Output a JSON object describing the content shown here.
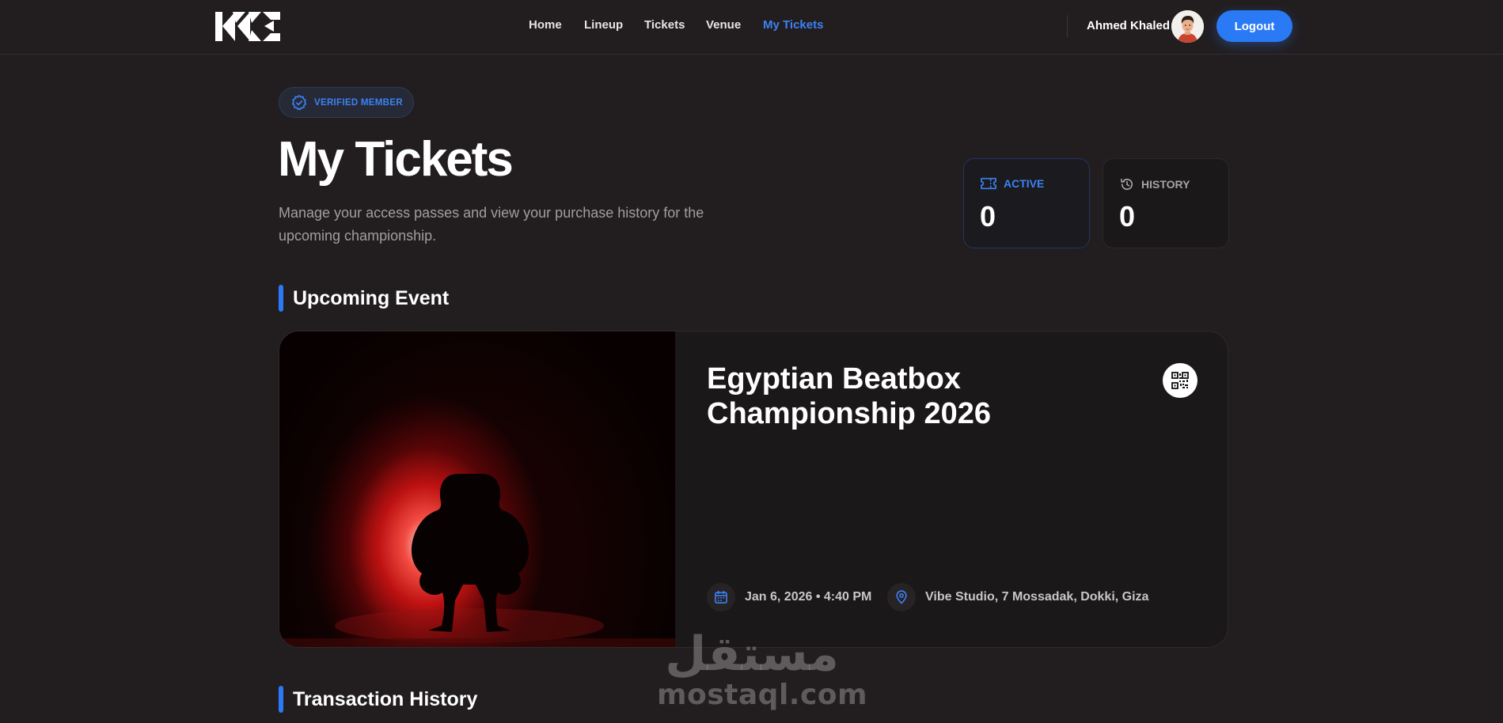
{
  "nav": {
    "links": [
      "Home",
      "Lineup",
      "Tickets",
      "Venue",
      "My Tickets"
    ],
    "active": "My Tickets",
    "user_name": "Ahmed Khaled",
    "logout_label": "Logout"
  },
  "header": {
    "badge": "VERIFIED MEMBER",
    "title": "My Tickets",
    "description": "Manage your access passes and view your purchase history for the upcoming championship."
  },
  "stats": {
    "active": {
      "label": "ACTIVE",
      "value": "0"
    },
    "history": {
      "label": "HISTORY",
      "value": "0"
    }
  },
  "sections": {
    "upcoming": "Upcoming Event",
    "history": "Transaction History"
  },
  "event": {
    "title": "Egyptian Beatbox Championship 2026",
    "datetime": "Jan 6, 2026 • 4:40 PM",
    "venue": "Vibe Studio, 7 Mossadak, Dokki, Giza"
  },
  "watermark": {
    "arabic": "مستقل",
    "latin": "mostaql.com"
  },
  "colors": {
    "background": "#221e20",
    "accent": "#2b7af5",
    "card": "#1b1819"
  },
  "icons": [
    "logo-icon",
    "avatar",
    "verified-badge-icon",
    "ticket-icon",
    "history-icon",
    "qr-code-icon",
    "calendar-icon",
    "location-pin-icon"
  ]
}
